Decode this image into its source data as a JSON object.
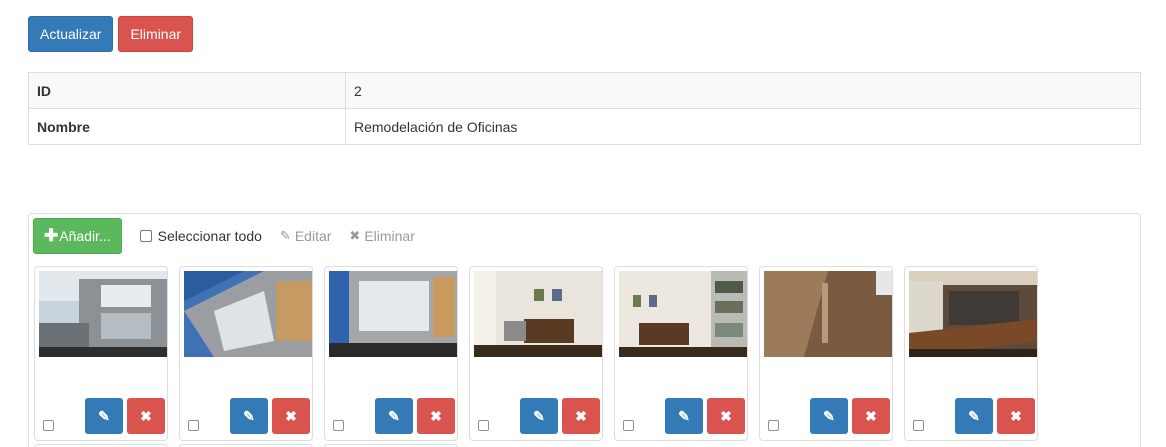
{
  "actions": {
    "update_label": "Actualizar",
    "delete_label": "Eliminar"
  },
  "details": {
    "rows": [
      {
        "label": "ID",
        "value": "2"
      },
      {
        "label": "Nombre",
        "value": "Remodelación de Oficinas"
      }
    ]
  },
  "gallery": {
    "add_label": "Añadir...",
    "select_all_label": "Seleccionar todo",
    "edit_label": "Editar",
    "delete_label": "Eliminar",
    "add_icon": "plus-icon",
    "edit_icon": "pencil-icon",
    "delete_icon": "times-icon",
    "images": [
      {
        "subject": "building-exterior"
      },
      {
        "subject": "building-exterior-tilted"
      },
      {
        "subject": "building-exterior-rotated"
      },
      {
        "subject": "office-room"
      },
      {
        "subject": "office-room-shelves"
      },
      {
        "subject": "tiled-wall"
      },
      {
        "subject": "meeting-room-table"
      }
    ]
  },
  "colors": {
    "primary": "#337ab7",
    "danger": "#d9534f",
    "success": "#5cb85c"
  }
}
